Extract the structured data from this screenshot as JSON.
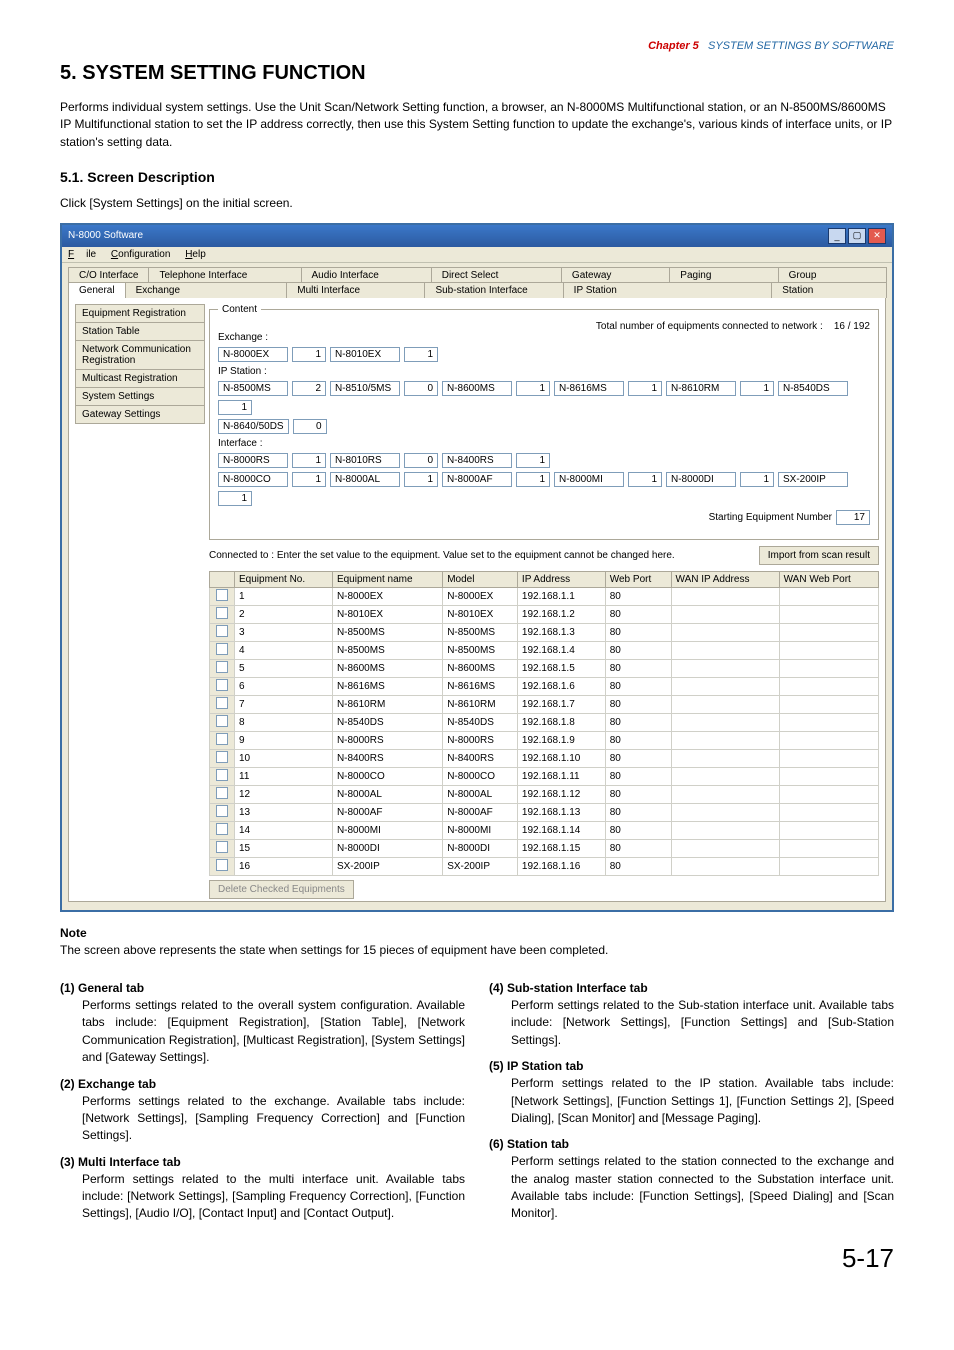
{
  "chapter": {
    "red": "Chapter 5",
    "blue": "SYSTEM SETTINGS BY SOFTWARE"
  },
  "h1": "5. SYSTEM SETTING FUNCTION",
  "intro": "Performs individual system settings. Use the Unit Scan/Network Setting function, a browser, an N-8000MS Multifunctional station, or an N-8500MS/8600MS IP Multifunctional station to set the IP address correctly, then use this System Setting function to update the exchange's, various kinds of interface units, or IP station's setting data.",
  "h2": "5.1. Screen Description",
  "lead": "Click [System Settings] on the initial screen.",
  "window": {
    "title": "N-8000 Software",
    "menu": {
      "file": "File",
      "config": "Configuration",
      "help": "Help"
    },
    "outerTabsRow1": [
      "C/O Interface",
      "Telephone Interface",
      "Audio Interface",
      "Direct Select",
      "Gateway",
      "Paging",
      "Group"
    ],
    "outerTabsRow2": [
      "General",
      "Exchange",
      "Multi Interface",
      "Sub-station Interface",
      "IP Station",
      "Station"
    ],
    "sideNav": [
      "Equipment Registration",
      "Station Table",
      "Network Communication Registration",
      "Multicast Registration",
      "System Settings",
      "Gateway Settings"
    ],
    "legend": "Content",
    "totalLabel": "Total number of equipments connected to network :",
    "totalValue": "16 / 192",
    "exchangeLabel": "Exchange :",
    "exRow": [
      {
        "m": "N-8000EX",
        "c": "1"
      },
      {
        "m": "N-8010EX",
        "c": "1"
      }
    ],
    "ipStationLabel": "IP Station :",
    "ipRow1": [
      {
        "m": "N-8500MS",
        "c": "2"
      },
      {
        "m": "N-8510/5MS",
        "c": "0"
      },
      {
        "m": "N-8600MS",
        "c": "1"
      },
      {
        "m": "N-8616MS",
        "c": "1"
      },
      {
        "m": "N-8610RM",
        "c": "1"
      },
      {
        "m": "N-8540DS",
        "c": "1"
      }
    ],
    "ipRow1b": [
      {
        "m": "N-8640/50DS",
        "c": "0"
      }
    ],
    "interfaceLabel": "Interface :",
    "ifRow": [
      {
        "m": "N-8000RS",
        "c": "1"
      },
      {
        "m": "N-8010RS",
        "c": "0"
      },
      {
        "m": "N-8400RS",
        "c": "1"
      }
    ],
    "ifRow2": [
      {
        "m": "N-8000CO",
        "c": "1"
      },
      {
        "m": "N-8000AL",
        "c": "1"
      },
      {
        "m": "N-8000AF",
        "c": "1"
      },
      {
        "m": "N-8000MI",
        "c": "1"
      },
      {
        "m": "N-8000DI",
        "c": "1"
      },
      {
        "m": "SX-200IP",
        "c": "1"
      }
    ],
    "startingLabel": "Starting Equipment Number",
    "startingVal": "17",
    "connectedText": "Connected to : Enter the set value to the equipment. Value set to the equipment cannot be changed here.",
    "importBtn": "Import from scan result",
    "headers": [
      "",
      "Equipment No.",
      "Equipment name",
      "Model",
      "IP Address",
      "Web Port",
      "WAN IP Address",
      "WAN Web Port"
    ],
    "rows": [
      {
        "no": "1",
        "name": "N-8000EX",
        "model": "N-8000EX",
        "ip": "192.168.1.1",
        "port": "80"
      },
      {
        "no": "2",
        "name": "N-8010EX",
        "model": "N-8010EX",
        "ip": "192.168.1.2",
        "port": "80"
      },
      {
        "no": "3",
        "name": "N-8500MS",
        "model": "N-8500MS",
        "ip": "192.168.1.3",
        "port": "80"
      },
      {
        "no": "4",
        "name": "N-8500MS",
        "model": "N-8500MS",
        "ip": "192.168.1.4",
        "port": "80"
      },
      {
        "no": "5",
        "name": "N-8600MS",
        "model": "N-8600MS",
        "ip": "192.168.1.5",
        "port": "80"
      },
      {
        "no": "6",
        "name": "N-8616MS",
        "model": "N-8616MS",
        "ip": "192.168.1.6",
        "port": "80"
      },
      {
        "no": "7",
        "name": "N-8610RM",
        "model": "N-8610RM",
        "ip": "192.168.1.7",
        "port": "80"
      },
      {
        "no": "8",
        "name": "N-8540DS",
        "model": "N-8540DS",
        "ip": "192.168.1.8",
        "port": "80"
      },
      {
        "no": "9",
        "name": "N-8000RS",
        "model": "N-8000RS",
        "ip": "192.168.1.9",
        "port": "80"
      },
      {
        "no": "10",
        "name": "N-8400RS",
        "model": "N-8400RS",
        "ip": "192.168.1.10",
        "port": "80"
      },
      {
        "no": "11",
        "name": "N-8000CO",
        "model": "N-8000CO",
        "ip": "192.168.1.11",
        "port": "80"
      },
      {
        "no": "12",
        "name": "N-8000AL",
        "model": "N-8000AL",
        "ip": "192.168.1.12",
        "port": "80"
      },
      {
        "no": "13",
        "name": "N-8000AF",
        "model": "N-8000AF",
        "ip": "192.168.1.13",
        "port": "80"
      },
      {
        "no": "14",
        "name": "N-8000MI",
        "model": "N-8000MI",
        "ip": "192.168.1.14",
        "port": "80"
      },
      {
        "no": "15",
        "name": "N-8000DI",
        "model": "N-8000DI",
        "ip": "192.168.1.15",
        "port": "80"
      },
      {
        "no": "16",
        "name": "SX-200IP",
        "model": "SX-200IP",
        "ip": "192.168.1.16",
        "port": "80"
      }
    ],
    "deleteBtn": "Delete Checked Equipments"
  },
  "noteHead": "Note",
  "noteBody": "The screen above represents the state when settings for 15 pieces of equipment have been completed.",
  "sections": {
    "s1h": "(1) General tab",
    "s1b": "Performs settings related to the overall system configuration. Available tabs include: [Equipment Registration], [Station Table], [Network Communication Registration], [Multicast Registration], [System Settings] and [Gateway Settings].",
    "s2h": "(2) Exchange tab",
    "s2b": "Performs settings related to the exchange. Available tabs include: [Network Settings], [Sampling Frequency Correction] and [Function Settings].",
    "s3h": "(3) Multi Interface tab",
    "s3b": "Perform settings related to the multi interface unit. Available tabs include: [Network Settings], [Sampling Frequency Correction], [Function Settings], [Audio I/O], [Contact Input] and [Contact Output].",
    "s4h": "(4) Sub-station Interface tab",
    "s4b": "Perform settings related to the Sub-station interface unit. Available tabs include: [Network Settings], [Function Settings] and [Sub-Station Settings].",
    "s5h": "(5) IP Station tab",
    "s5b": "Perform settings related to the IP station. Available tabs include: [Network Settings], [Function Settings 1], [Function Settings 2], [Speed Dialing], [Scan Monitor] and [Message Paging].",
    "s6h": "(6) Station tab",
    "s6b": "Perform settings related to the station connected to the exchange and the analog master station connected to the Substation interface unit. Available tabs include: [Function Settings], [Speed Dialing] and [Scan Monitor]."
  },
  "pageNum": "5-17"
}
